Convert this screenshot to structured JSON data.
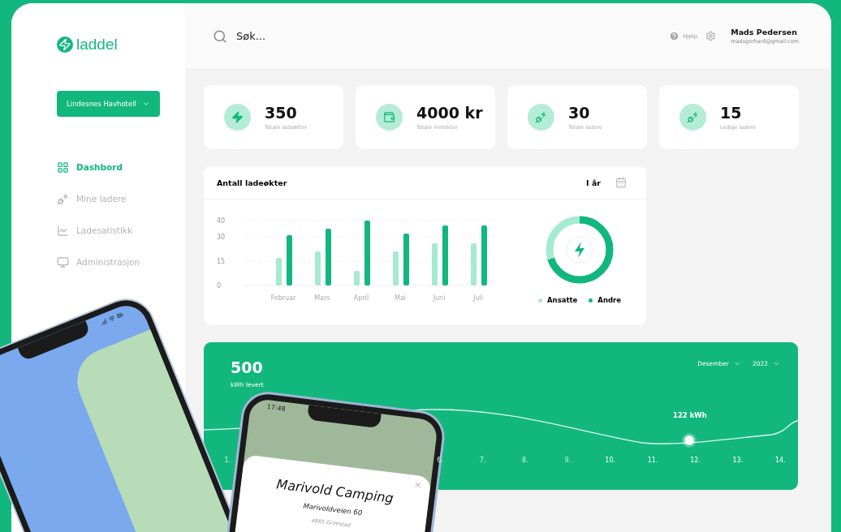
{
  "sidebar": {
    "logo": "laddel",
    "location_select": "Lindesnes Havhotell",
    "items": [
      {
        "label": "Dashbord",
        "selected": true
      },
      {
        "label": "Mine ladere",
        "selected": false
      },
      {
        "label": "Ladesatistikk",
        "selected": false
      },
      {
        "label": "Administrasjon",
        "selected": false
      }
    ]
  },
  "header": {
    "search": {
      "placeholder": "Søk..."
    },
    "help": "Hjelp",
    "user": {
      "name": "Mads Pedersen",
      "email": "madsgerhard@gmail.com"
    }
  },
  "stats": [
    {
      "value": "350",
      "label": "Totale ladeøkter"
    },
    {
      "value": "4000 kr",
      "label": "Totale inntekter"
    },
    {
      "value": "30",
      "label": "Totale ladere"
    },
    {
      "value": "15",
      "label": "Ledige ladere"
    }
  ],
  "sessions_card": {
    "title": "Antall ladeøkter",
    "period": "I år",
    "chart_data": {
      "type": "bar",
      "categories": [
        "Februar",
        "Mars",
        "April",
        "Mai",
        "Juni",
        "Juli"
      ],
      "yticks": [
        0,
        15,
        30,
        40
      ],
      "ylim": [
        0,
        40
      ],
      "grid": true,
      "series": [
        {
          "name": "Ansatte",
          "color": "#a6ead0",
          "values": [
            17,
            21,
            9,
            21,
            26,
            26
          ]
        },
        {
          "name": "Andre",
          "color": "#12b77e",
          "values": [
            31,
            35,
            40,
            32,
            37,
            37
          ]
        }
      ]
    }
  },
  "energy_card": {
    "value": "500",
    "unit": "kWh levert",
    "month": "Desember",
    "year": "2022",
    "highlight": "122 kWh",
    "days": [
      {
        "label": "1.",
        "dimmed": true
      },
      {
        "label": "6.",
        "dimmed": true
      },
      {
        "label": "7.",
        "dimmed": true
      },
      {
        "label": "8.",
        "dimmed": true
      },
      {
        "label": "9.",
        "dimmed": true
      },
      {
        "label": "10.",
        "dimmed": false
      },
      {
        "label": "11.",
        "dimmed": false
      },
      {
        "label": "12.",
        "dimmed": false
      },
      {
        "label": "13.",
        "dimmed": false
      },
      {
        "label": "14.",
        "dimmed": false
      }
    ]
  },
  "phone_popup": {
    "time": "17:48",
    "title": "Marivold Camping",
    "address": "Marivoldveien 60",
    "city": "4885 Grimstad"
  }
}
